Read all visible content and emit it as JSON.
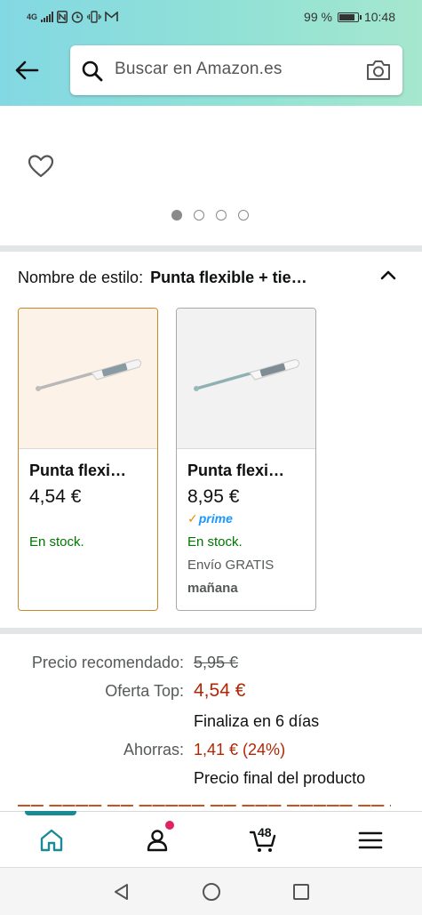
{
  "status_bar": {
    "network": "4G",
    "battery_percent": "99 %",
    "time": "10:48"
  },
  "header": {
    "search_placeholder": "Buscar en Amazon.es"
  },
  "image_carousel": {
    "page_count": 4,
    "active_index": 0
  },
  "style_selector": {
    "label": "Nombre de estilo:",
    "value": "Punta flexible + tie…",
    "options": [
      {
        "title": "Punta flexi…",
        "price": "4,54 €",
        "prime": "",
        "stock": "En stock.",
        "shipping": "",
        "shipping_day": "",
        "selected": true
      },
      {
        "title": "Punta flexi…",
        "price": "8,95 €",
        "prime": "prime",
        "stock": "En stock.",
        "shipping": "Envío GRATIS",
        "shipping_day": "mañana",
        "selected": false
      }
    ]
  },
  "pricing": {
    "list_price_label": "Precio recomendado:",
    "list_price": "5,95 €",
    "deal_label": "Oferta Top:",
    "deal_price": "4,54 €",
    "deal_note": "Finaliza en 6 días",
    "savings_label": "Ahorras:",
    "savings": "1,41 € (24%)",
    "final_note": "Precio final del producto"
  },
  "bottom_nav": {
    "cart_count": "48",
    "active": "home"
  },
  "colors": {
    "header_gradient_start": "#82d8e3",
    "header_gradient_end": "#a6e7ce",
    "selected_border": "#c7882a",
    "price_red": "#b12704",
    "stock_green": "#007600",
    "nav_accent": "#1a8b94"
  }
}
